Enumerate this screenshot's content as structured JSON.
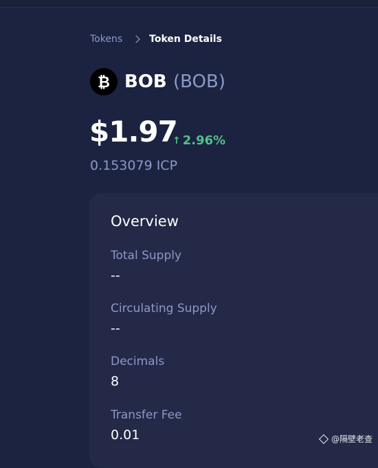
{
  "breadcrumb": {
    "parent": "Tokens",
    "current": "Token Details"
  },
  "token": {
    "logo_icon": "bitcoin-b-icon",
    "logo_glyph": "₿",
    "name": "BOB",
    "symbol": "(BOB)"
  },
  "price": {
    "usd": "$1.97",
    "change_arrow": "↑",
    "change": "2.96%",
    "icp": "0.153079 ICP"
  },
  "overview": {
    "title": "Overview",
    "fields": [
      {
        "label": "Total Supply",
        "value": "--"
      },
      {
        "label": "Circulating Supply",
        "value": "--"
      },
      {
        "label": "Decimals",
        "value": "8"
      },
      {
        "label": "Transfer Fee",
        "value": "0.01"
      }
    ]
  },
  "watermark": {
    "text": "@隔壁老查"
  },
  "colors": {
    "background": "#1c2340",
    "card": "#232947",
    "muted_text": "#8e98c8",
    "positive": "#4fc28a"
  }
}
